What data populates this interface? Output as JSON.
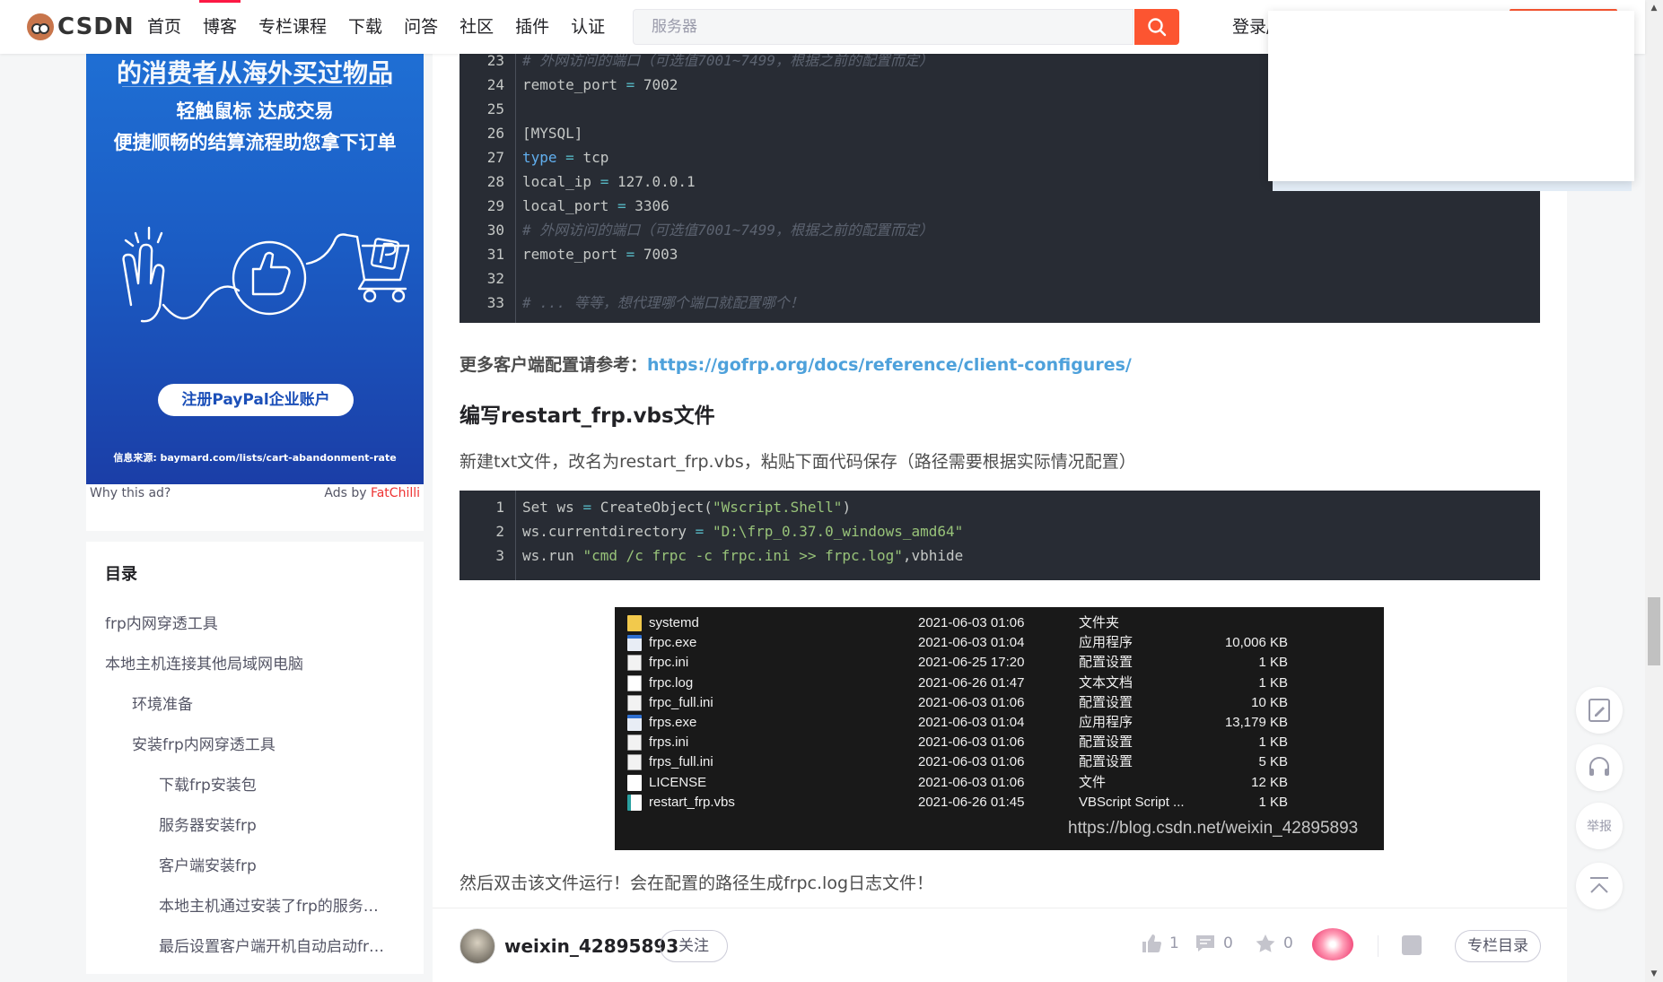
{
  "nav": {
    "logo_text": "CSDN",
    "items": [
      "首页",
      "博客",
      "专栏课程",
      "下载",
      "问答",
      "社区",
      "插件",
      "认证"
    ],
    "active_index": 1,
    "search_placeholder": "服务器",
    "login_label": "登录/"
  },
  "ad": {
    "title": "的消费者从海外买过物品",
    "sub1": "轻触鼠标 达成交易",
    "sub2": "便捷顺畅的结算流程助您拿下订单",
    "button": "注册PayPal企业账户",
    "source": "信息来源: baymard.com/lists/cart-abandonment-rate",
    "why": "Why this ad?",
    "ads_by": "Ads by ",
    "ads_by_brand": "FatChilli"
  },
  "toc": {
    "title": "目录",
    "items": [
      {
        "label": "frp内网穿透工具",
        "level": 1
      },
      {
        "label": "本地主机连接其他局域网电脑",
        "level": 1
      },
      {
        "label": "环境准备",
        "level": 2
      },
      {
        "label": "安装frp内网穿透工具",
        "level": 2
      },
      {
        "label": "下载frp安装包",
        "level": 3
      },
      {
        "label": "服务器安装frp",
        "level": 3
      },
      {
        "label": "客户端安装frp",
        "level": 3
      },
      {
        "label": "本地主机通过安装了frp的服务器…",
        "level": 3
      },
      {
        "label": "最后设置客户端开机自动启动frp…",
        "level": 3
      }
    ]
  },
  "code1": [
    {
      "n": "23",
      "tokens": [
        {
          "t": "# 外网访问的端口（可选值7001~7499，根据之前的配置而定）",
          "c": "cm"
        }
      ]
    },
    {
      "n": "24",
      "tokens": [
        {
          "t": "remote_port "
        },
        {
          "t": "=",
          "c": "op"
        },
        {
          "t": " 7002"
        }
      ]
    },
    {
      "n": "25",
      "tokens": []
    },
    {
      "n": "26",
      "tokens": [
        {
          "t": "[MYSQL]"
        }
      ]
    },
    {
      "n": "27",
      "tokens": [
        {
          "t": "type",
          "c": "kw"
        },
        {
          "t": " "
        },
        {
          "t": "=",
          "c": "op"
        },
        {
          "t": " tcp"
        }
      ]
    },
    {
      "n": "28",
      "tokens": [
        {
          "t": "local_ip "
        },
        {
          "t": "=",
          "c": "op"
        },
        {
          "t": " 127.0.0.1"
        }
      ]
    },
    {
      "n": "29",
      "tokens": [
        {
          "t": "local_port "
        },
        {
          "t": "=",
          "c": "op"
        },
        {
          "t": " 3306"
        }
      ]
    },
    {
      "n": "30",
      "tokens": [
        {
          "t": "# 外网访问的端口（可选值7001~7499，根据之前的配置而定）",
          "c": "cm"
        }
      ]
    },
    {
      "n": "31",
      "tokens": [
        {
          "t": "remote_port "
        },
        {
          "t": "=",
          "c": "op"
        },
        {
          "t": " 7003"
        }
      ]
    },
    {
      "n": "32",
      "tokens": []
    },
    {
      "n": "33",
      "tokens": [
        {
          "t": "# ... 等等，想代理哪个端口就配置哪个！",
          "c": "cm"
        }
      ]
    }
  ],
  "article": {
    "more_label": "更多客户端配置请参考：",
    "more_link": "https://gofrp.org/docs/reference/client-configures/",
    "heading": "编写restart_frp.vbs文件",
    "instruction": "新建txt文件，改名为restart_frp.vbs，粘贴下面代码保存（路径需要根据实际情况配置）",
    "after_image": "然后双击该文件运行！会在配置的路径生成frpc.log日志文件！"
  },
  "code2": [
    {
      "n": "1",
      "tokens": [
        {
          "t": "Set ws "
        },
        {
          "t": "=",
          "c": "op"
        },
        {
          "t": " CreateObject("
        },
        {
          "t": "\"Wscript.Shell\"",
          "c": "str"
        },
        {
          "t": ")"
        }
      ]
    },
    {
      "n": "2",
      "tokens": [
        {
          "t": "ws.currentdirectory "
        },
        {
          "t": "=",
          "c": "op"
        },
        {
          "t": " "
        },
        {
          "t": "\"D:\\frp_0.37.0_windows_amd64\"",
          "c": "str"
        }
      ]
    },
    {
      "n": "3",
      "tokens": [
        {
          "t": "ws.run "
        },
        {
          "t": "\"cmd /c frpc -c frpc.ini >> frpc.log\"",
          "c": "str"
        },
        {
          "t": ",vbhide"
        }
      ]
    }
  ],
  "files": [
    {
      "name": "systemd",
      "date": "2021-06-03 01:06",
      "type": "文件夹",
      "size": "",
      "icon": "folder-icon"
    },
    {
      "name": "frpc.exe",
      "date": "2021-06-03 01:04",
      "type": "应用程序",
      "size": "10,006 KB",
      "icon": "exe-icon"
    },
    {
      "name": "frpc.ini",
      "date": "2021-06-25 17:20",
      "type": "配置设置",
      "size": "1 KB",
      "icon": "ini-icon"
    },
    {
      "name": "frpc.log",
      "date": "2021-06-26 01:47",
      "type": "文本文档",
      "size": "1 KB",
      "icon": "text-file-icon"
    },
    {
      "name": "frpc_full.ini",
      "date": "2021-06-03 01:06",
      "type": "配置设置",
      "size": "10 KB",
      "icon": "ini-icon"
    },
    {
      "name": "frps.exe",
      "date": "2021-06-03 01:04",
      "type": "应用程序",
      "size": "13,179 KB",
      "icon": "exe-icon"
    },
    {
      "name": "frps.ini",
      "date": "2021-06-03 01:06",
      "type": "配置设置",
      "size": "1 KB",
      "icon": "ini-icon"
    },
    {
      "name": "frps_full.ini",
      "date": "2021-06-03 01:06",
      "type": "配置设置",
      "size": "5 KB",
      "icon": "ini-icon"
    },
    {
      "name": "LICENSE",
      "date": "2021-06-03 01:06",
      "type": "文件",
      "size": "12 KB",
      "icon": "file-icon"
    },
    {
      "name": "restart_frp.vbs",
      "date": "2021-06-26 01:45",
      "type": "VBScript Script ...",
      "size": "1 KB",
      "icon": "vbs-icon"
    }
  ],
  "watermark": "https://blog.csdn.net/weixin_42895893",
  "toolbar": {
    "author": "weixin_42895893",
    "follow": "关注",
    "likes": "1",
    "comments": "0",
    "favorites": "0",
    "column_toc": "专栏目录"
  },
  "side_tools": {
    "report": "举报"
  },
  "colors": {
    "brand": "#fc5531",
    "link": "#4ea1db",
    "code_bg": "#282c34"
  }
}
